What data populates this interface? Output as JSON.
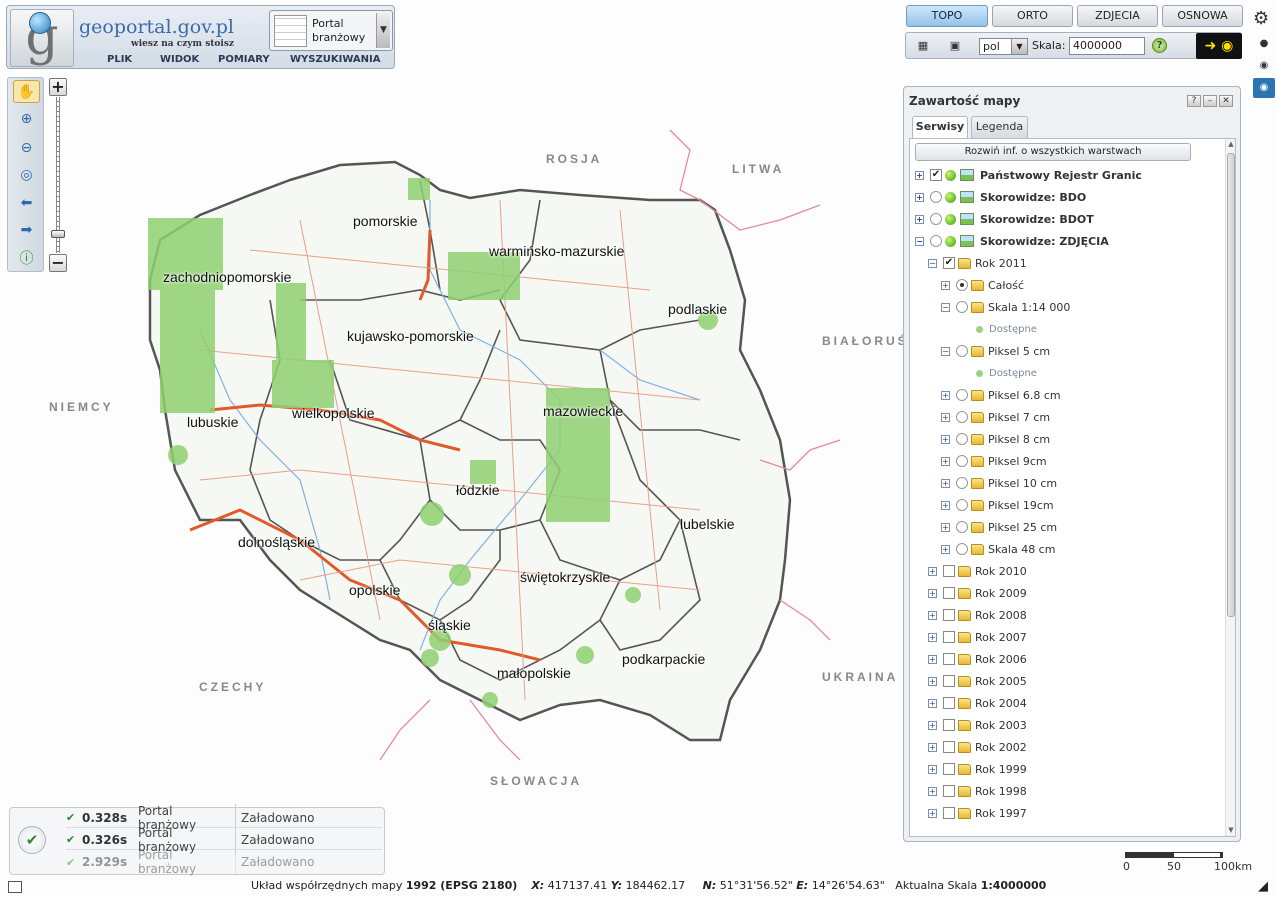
{
  "header": {
    "brand": "geoportal.gov.pl",
    "tagline": "wiesz na czym stoisz",
    "portal_select": "Portal branżowy",
    "menu": [
      "PLIK",
      "WIDOK",
      "POMIARY",
      "WYSZUKIWANIA"
    ]
  },
  "map_tabs": [
    "TOPO",
    "ORTO",
    "ZDJECIA",
    "OSNOWA"
  ],
  "active_map_tab": "TOPO",
  "toolbar": {
    "language": "pol",
    "scale_label": "Skala:",
    "scale_value": "4000000",
    "help": "?"
  },
  "zoom_tools": {
    "icons": [
      "hand-pan-icon",
      "zoom-in-icon",
      "zoom-out-icon",
      "zoom-extent-icon",
      "back-arrow-icon",
      "forward-arrow-icon",
      "info-icon"
    ],
    "plus": "+",
    "minus": "−"
  },
  "map": {
    "countries": [
      "ROSJA",
      "LITWA",
      "BIAŁORUŚ",
      "NIEMCY",
      "CZECHY",
      "SŁOWACJA",
      "UKRAINA"
    ],
    "regions": [
      "pomorskie",
      "warmińsko-mazurskie",
      "zachodniopomorskie",
      "podlaskie",
      "kujawsko-pomorskie",
      "wielkopolskie",
      "mazowieckie",
      "lubuskie",
      "łódzkie",
      "lubelskie",
      "dolnośląskie",
      "świętokrzyskie",
      "opolskie",
      "śląskie",
      "małopolskie",
      "podkarpackie"
    ]
  },
  "layer_panel": {
    "title": "Zawartość mapy",
    "tabs": [
      "Serwisy",
      "Legenda"
    ],
    "expand_all": "Rozwiń inf. o wszystkich warstwach",
    "items": [
      {
        "label": "Państwowy Rejestr Granic",
        "level": 0,
        "bold": true
      },
      {
        "label": "Skorowidze: BDO",
        "level": 0,
        "bold": true
      },
      {
        "label": "Skorowidze: BDOT",
        "level": 0,
        "bold": true
      },
      {
        "label": "Skorowidze: ZDJĘCIA",
        "level": 0,
        "bold": true
      },
      {
        "label": "Rok 2011",
        "level": 1
      },
      {
        "label": "Całość",
        "level": 2
      },
      {
        "label": "Skala 1:14 000",
        "level": 2
      },
      {
        "label": "Dostępne",
        "level": 3
      },
      {
        "label": "Piksel 5 cm",
        "level": 2
      },
      {
        "label": "Dostępne",
        "level": 3
      },
      {
        "label": "Piksel 6.8 cm",
        "level": 2
      },
      {
        "label": "Piksel 7 cm",
        "level": 2
      },
      {
        "label": "Piksel 8 cm",
        "level": 2
      },
      {
        "label": "Piksel 9cm",
        "level": 2
      },
      {
        "label": "Piksel 10 cm",
        "level": 2
      },
      {
        "label": "Piksel 19cm",
        "level": 2
      },
      {
        "label": "Piksel 25 cm",
        "level": 2
      },
      {
        "label": "Skala 48 cm",
        "level": 2
      },
      {
        "label": "Rok 2010",
        "level": 1
      },
      {
        "label": "Rok 2009",
        "level": 1
      },
      {
        "label": "Rok 2008",
        "level": 1
      },
      {
        "label": "Rok 2007",
        "level": 1
      },
      {
        "label": "Rok 2006",
        "level": 1
      },
      {
        "label": "Rok 2005",
        "level": 1
      },
      {
        "label": "Rok 2004",
        "level": 1
      },
      {
        "label": "Rok 2003",
        "level": 1
      },
      {
        "label": "Rok 2002",
        "level": 1
      },
      {
        "label": "Rok 1999",
        "level": 1
      },
      {
        "label": "Rok 1998",
        "level": 1
      },
      {
        "label": "Rok 1997",
        "level": 1
      }
    ]
  },
  "status": {
    "rows": [
      {
        "time": "0.328s",
        "portal": "Portal branżowy",
        "state": "Załadowano"
      },
      {
        "time": "0.326s",
        "portal": "Portal branżowy",
        "state": "Załadowano"
      },
      {
        "time": "2.929s",
        "portal": "Portal branżowy",
        "state": "Załadowano"
      }
    ]
  },
  "coords": {
    "system_label": "Układ współrzędnych mapy",
    "system_value": "1992 (EPSG 2180)",
    "x_label": "X:",
    "x_value": "417137.41",
    "y_label": "Y:",
    "y_value": "184462.17",
    "n_label": "N:",
    "n_value": "51°31'56.52\"",
    "e_label": "E:",
    "e_value": "14°26'54.63\"",
    "scale_label": "Aktualna Skala",
    "scale_value": "1:4000000"
  },
  "scale_bar": {
    "ticks": [
      "0",
      "50",
      "100km"
    ]
  },
  "colors": {
    "accent": "#2d74b3",
    "coverage": "#8fd071",
    "border": "#444444",
    "roads": "#e05a2a"
  }
}
